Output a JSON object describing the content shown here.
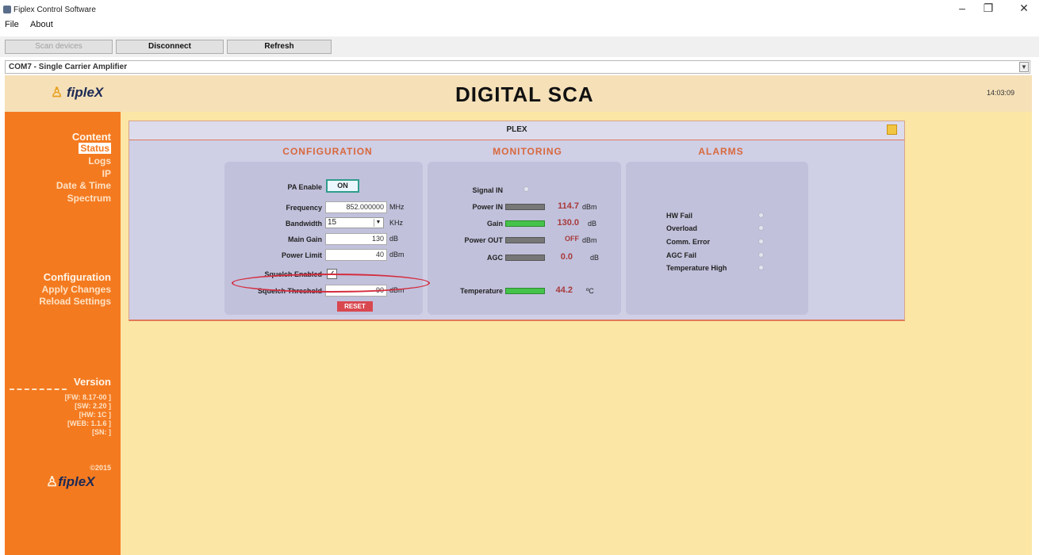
{
  "window": {
    "title": "Fiplex Control Software",
    "minimize": "–",
    "maximize": "❐",
    "close": "✕"
  },
  "menu": {
    "file": "File",
    "about": "About"
  },
  "toolbar": {
    "scan": "Scan devices",
    "disconnect": "Disconnect",
    "refresh": "Refresh"
  },
  "device_select": {
    "value": "COM7 - Single Carrier Amplifier"
  },
  "header": {
    "logo": "fipleX",
    "title": "DIGITAL SCA",
    "time": "14:03:09"
  },
  "sidebar": {
    "content": "Content",
    "status": "Status",
    "logs": "Logs",
    "ip": "IP",
    "datetime": "Date & Time",
    "spectrum": "Spectrum",
    "configuration": "Configuration",
    "apply": "Apply Changes",
    "reload": "Reload Settings",
    "version": "Version",
    "versions": [
      "[FW: 8.17-00 ]",
      "[SW: 2.20 ]",
      "[HW: 1C ]",
      "[WEB: 1.1.6 ]",
      "[SN: ]"
    ],
    "copyright": "©2015",
    "logo": "fipleX"
  },
  "panel": {
    "title": "PLEX",
    "configuration": {
      "title": "CONFIGURATION",
      "pa_enable": "PA Enable",
      "pa_state": "ON",
      "frequency": "Frequency",
      "frequency_value": "852.000000",
      "frequency_unit": "MHz",
      "bandwidth": "Bandwidth",
      "bandwidth_value": "15",
      "bandwidth_unit": "KHz",
      "main_gain": "Main Gain",
      "main_gain_value": "130",
      "main_gain_unit": "dB",
      "power_limit": "Power Limit",
      "power_limit_value": "40",
      "power_limit_unit": "dBm",
      "squelch_enabled": "Squelch Enabled",
      "squelch_checked": true,
      "squelch_threshold": "Squelch Threshold",
      "squelch_threshold_value": "-90",
      "squelch_threshold_unit": "dBm",
      "reset": "RESET"
    },
    "monitoring": {
      "title": "MONITORING",
      "signal_in": "Signal IN",
      "power_in": "Power IN",
      "power_in_value": "114.7",
      "power_in_unit": "dBm",
      "gain": "Gain",
      "gain_value": "130.0",
      "gain_unit": "dB",
      "power_out": "Power OUT",
      "power_out_value": "OFF",
      "power_out_unit": "dBm",
      "agc": "AGC",
      "agc_value": "0.0",
      "agc_unit": "dB",
      "temperature": "Temperature",
      "temperature_value": "44.2",
      "temperature_unit": "ºC"
    },
    "alarms": {
      "title": "ALARMS",
      "items": [
        "HW Fail",
        "Overload",
        "Comm. Error",
        "AGC Fail",
        "Temperature High"
      ]
    }
  }
}
